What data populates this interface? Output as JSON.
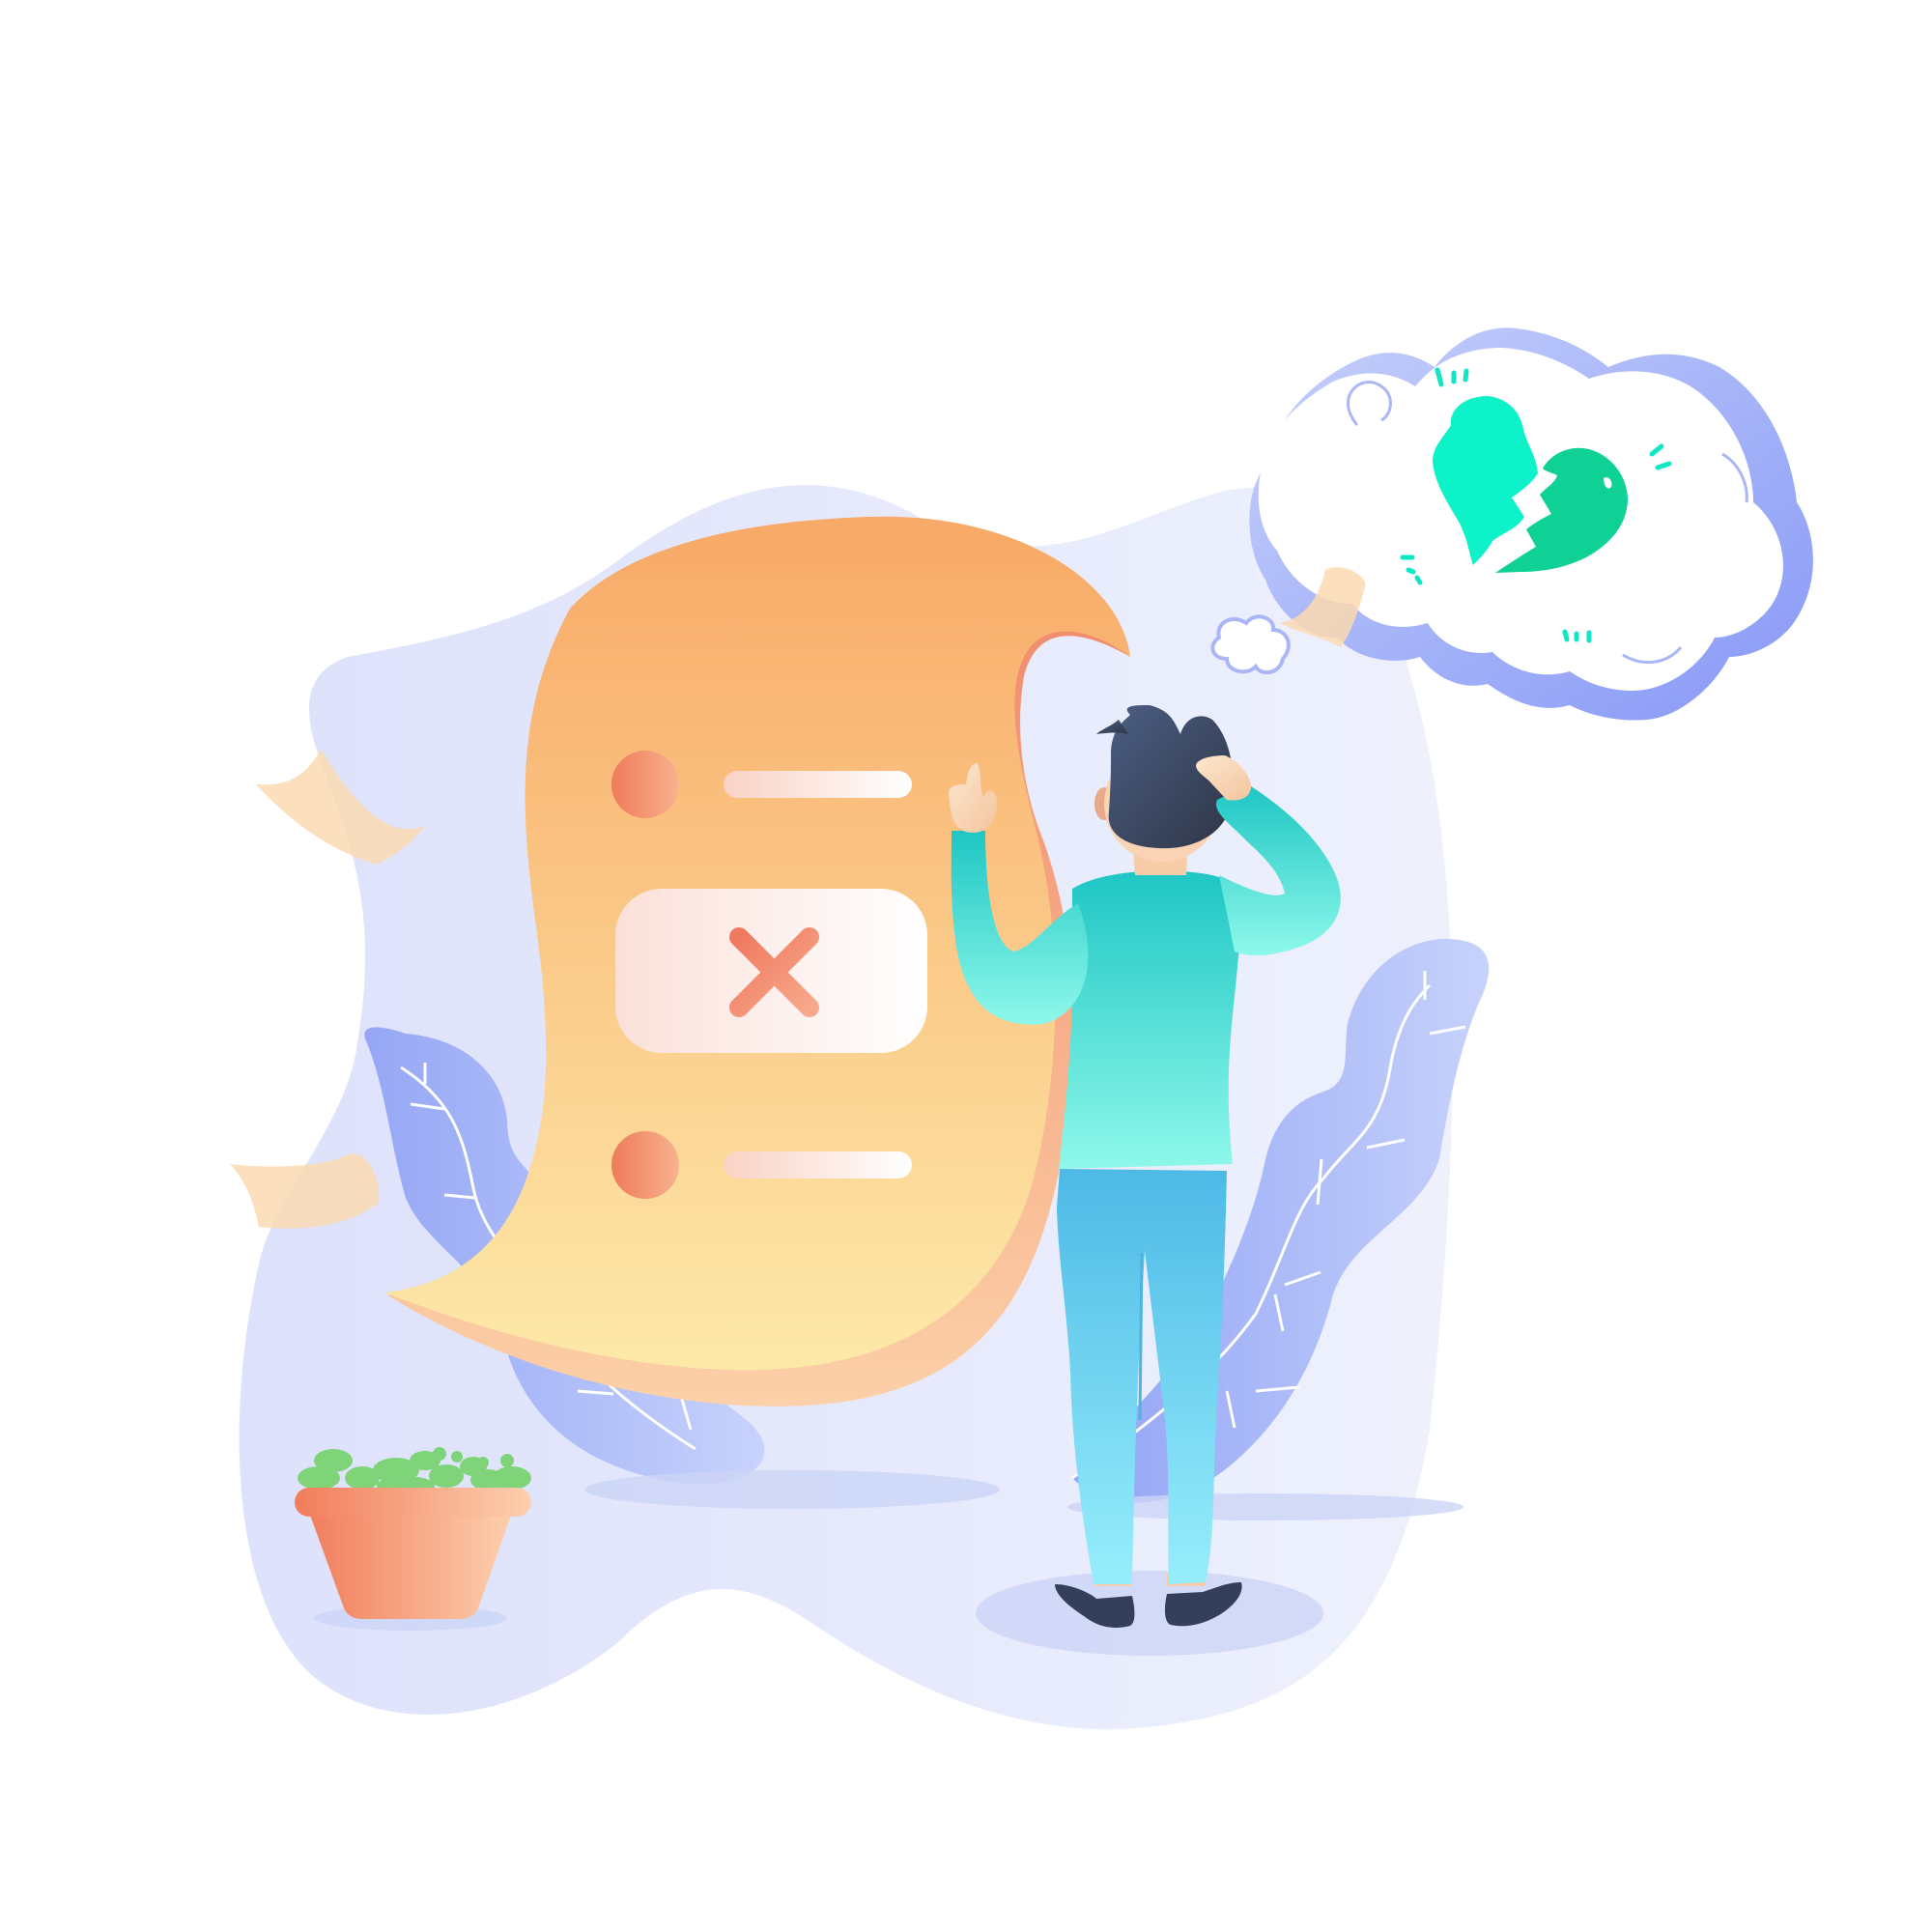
{
  "illustration": {
    "subject": "person-confused-by-rejected-document",
    "icons": [
      "close-icon",
      "broken-heart-icon",
      "thought-cloud-icon",
      "plant-pot-icon"
    ]
  },
  "colors": {
    "background": "#ffffff",
    "blob": "#e2e6fb",
    "paper_top": "#f8a967",
    "paper_bottom": "#fce8a6",
    "accent_red": "#ef7f62",
    "cloud_outline": "#8ea2f6",
    "heart_left": "#0ef2ca",
    "heart_right": "#0fd196",
    "shirt": "#2ecfc8",
    "pants": "#62c5ec",
    "hair": "#3b4a64",
    "pot": "#f59a73",
    "plant": "#7fd47a"
  }
}
